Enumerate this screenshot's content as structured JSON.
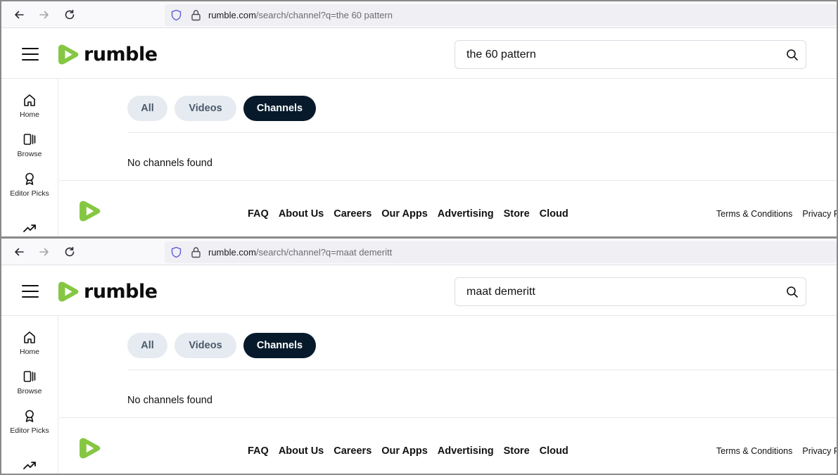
{
  "panels": [
    {
      "browser": {
        "url_host": "rumble.com",
        "url_path": "/search/channel?q=the 60 pattern"
      },
      "header": {
        "logo_text": "rumble",
        "search_value": "the 60 pattern"
      },
      "sidebar": {
        "items": [
          {
            "label": "Home"
          },
          {
            "label": "Browse"
          },
          {
            "label": "Editor Picks"
          }
        ]
      },
      "filters": {
        "all": "All",
        "videos": "Videos",
        "channels": "Channels",
        "active": "Channels"
      },
      "results": {
        "empty_message": "No channels found"
      },
      "footer": {
        "links": [
          "FAQ",
          "About Us",
          "Careers",
          "Our Apps",
          "Advertising",
          "Store",
          "Cloud"
        ],
        "legal": [
          "Terms & Conditions",
          "Privacy P"
        ]
      }
    },
    {
      "browser": {
        "url_host": "rumble.com",
        "url_path": "/search/channel?q=maat demeritt"
      },
      "header": {
        "logo_text": "rumble",
        "search_value": "maat demeritt"
      },
      "sidebar": {
        "items": [
          {
            "label": "Home"
          },
          {
            "label": "Browse"
          },
          {
            "label": "Editor Picks"
          }
        ]
      },
      "filters": {
        "all": "All",
        "videos": "Videos",
        "channels": "Channels",
        "active": "Channels"
      },
      "results": {
        "empty_message": "No channels found"
      },
      "footer": {
        "links": [
          "FAQ",
          "About Us",
          "Careers",
          "Our Apps",
          "Advertising",
          "Store",
          "Cloud"
        ],
        "legal": [
          "Terms & Conditions",
          "Privacy P"
        ]
      }
    }
  ],
  "colors": {
    "brand_green": "#85c742",
    "active_pill": "#061a2b",
    "inactive_pill": "#e6ebf1",
    "frame": "#8a8a8a"
  },
  "icons": [
    "back-arrow-icon",
    "forward-arrow-icon",
    "reload-icon",
    "shield-icon",
    "lock-icon",
    "hamburger-menu-icon",
    "rumble-logo-icon",
    "search-icon",
    "home-icon",
    "browse-icon",
    "editor-picks-icon",
    "trending-icon"
  ]
}
